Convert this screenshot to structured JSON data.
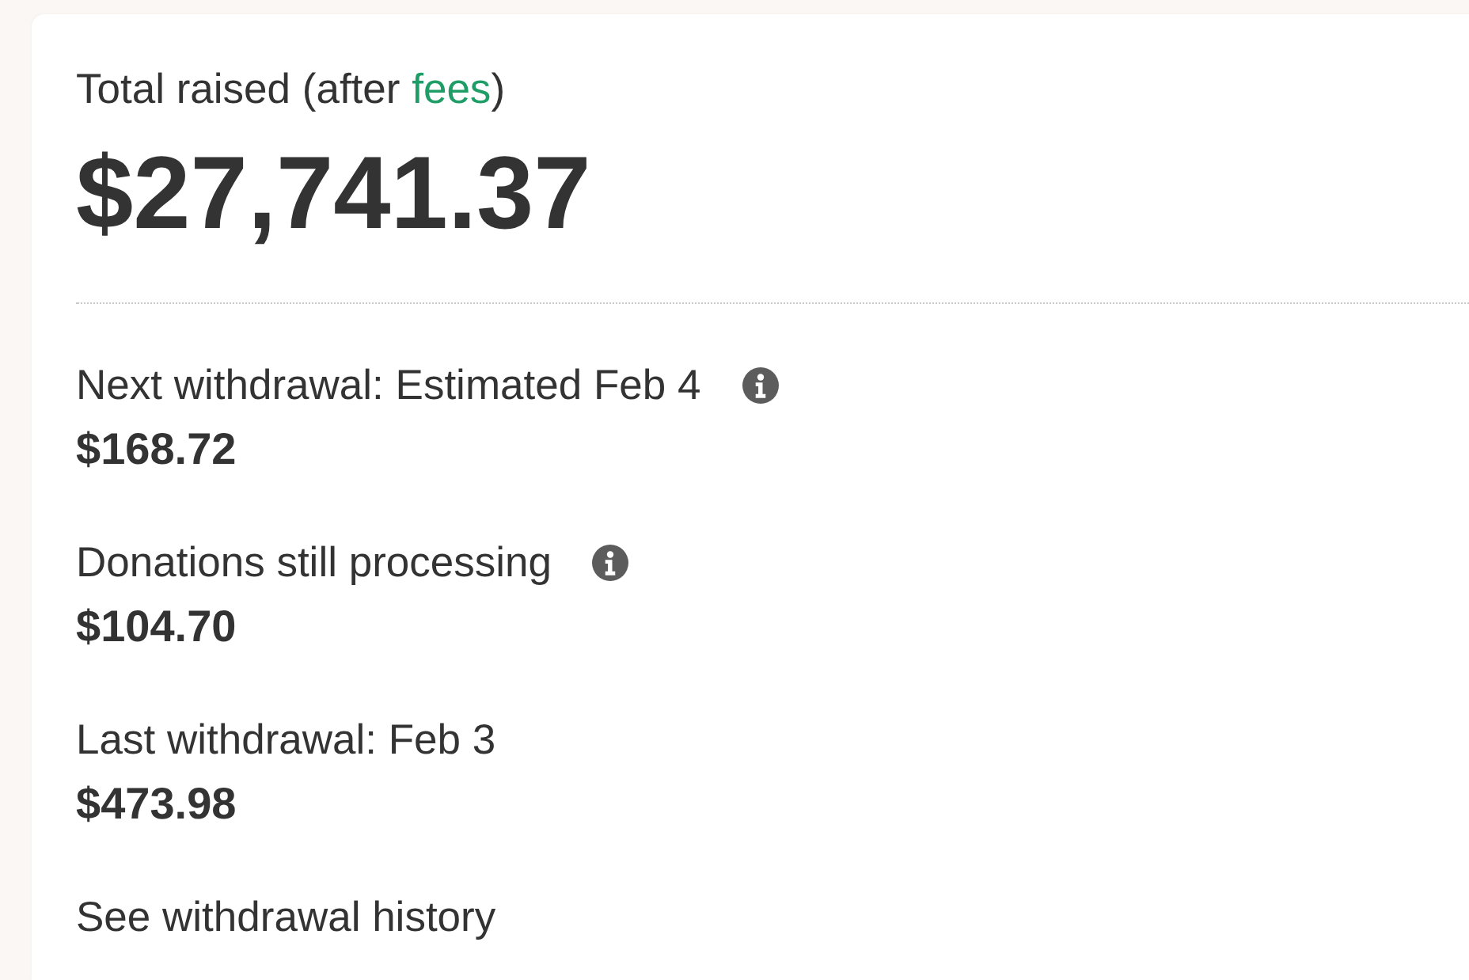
{
  "summary": {
    "heading": [
      {
        "kind": "text",
        "text": "Total raised (after "
      },
      {
        "kind": "link",
        "text": "fees"
      },
      {
        "kind": "text",
        "text": ")"
      }
    ],
    "total": "$27,741.37"
  },
  "withdrawals": [
    {
      "label": "Next withdrawal: Estimated Feb 4",
      "info": true,
      "amount": "$168.72"
    },
    {
      "label": "Donations still processing",
      "info": true,
      "amount": "$104.70"
    },
    {
      "label": "Last withdrawal: Feb 3",
      "info": false,
      "amount": "$473.98"
    }
  ],
  "history_link": "See withdrawal history"
}
